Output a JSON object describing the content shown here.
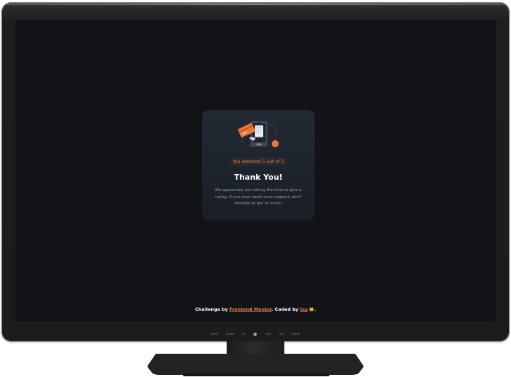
{
  "rating_card": {
    "selected_text": "You selected 5 out of 5",
    "title": "Thank You!",
    "message": "We appreciate you taking the time to give a rating. If you ever need more support, don't hesitate to get in touch!",
    "illustration_icon": "phone-payment-illustration-icon"
  },
  "attribution": {
    "prefix": "Challenge by",
    "link1": "Frontend Mentor",
    "middle": ". Coded by",
    "link2": "tsy",
    "suffix": "."
  },
  "monitor_controls": {
    "items": [
      "MENU",
      "DOWN",
      "UP",
      "EXIT",
      "LUX",
      "SHAKE"
    ]
  },
  "colors": {
    "accent": "#f3773b",
    "screen_bg": "#121316",
    "card_bg": "#1a1e25",
    "muted_text": "#959eac"
  }
}
